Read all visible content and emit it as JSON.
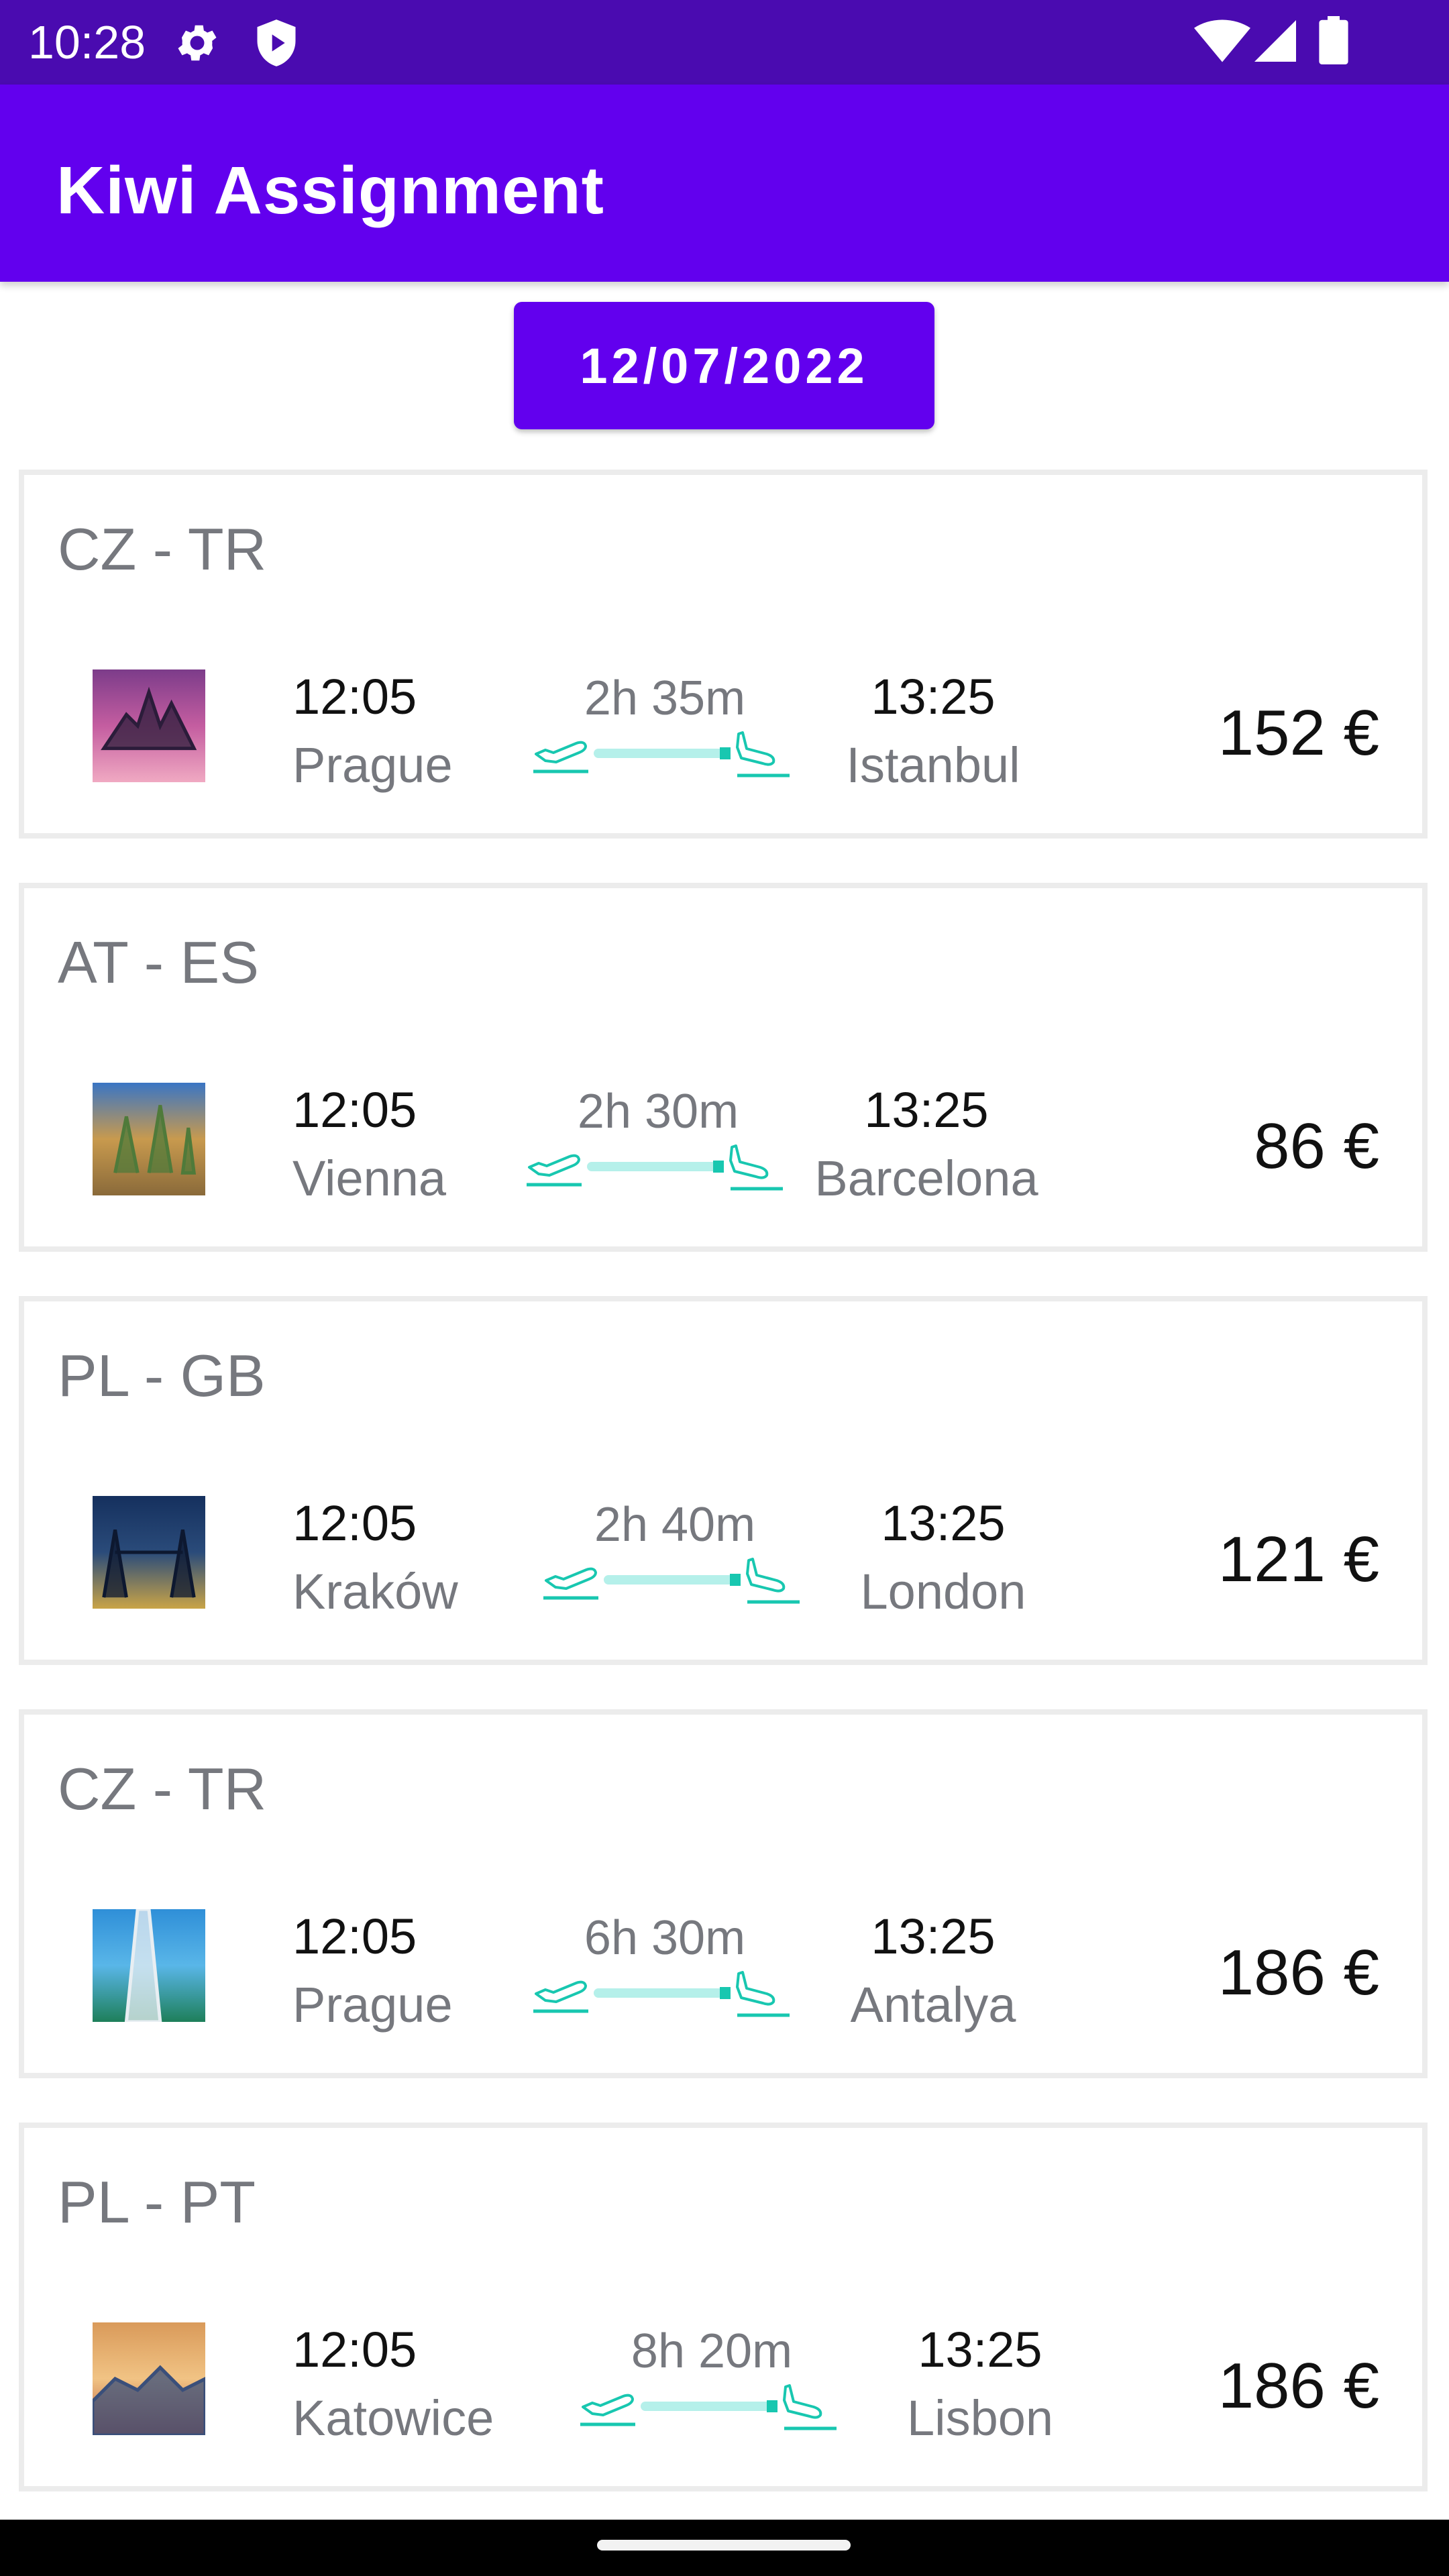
{
  "status_bar": {
    "time": "10:28",
    "icons": [
      "settings-icon",
      "shield-play-icon",
      "wifi-icon",
      "signal-icon",
      "battery-icon"
    ]
  },
  "app_bar": {
    "title": "Kiwi Assignment"
  },
  "date_button": {
    "label": "12/07/2022"
  },
  "flights": [
    {
      "route": "CZ - TR",
      "departure_time": "12:05",
      "departure_city": "Prague",
      "duration": "2h 35m",
      "arrival_time": "13:25",
      "arrival_city": "Istanbul",
      "price": "152 €",
      "image": "istanbul-thumbnail"
    },
    {
      "route": "AT - ES",
      "departure_time": "12:05",
      "departure_city": "Vienna",
      "duration": "2h 30m",
      "arrival_time": "13:25",
      "arrival_city": "Barcelona",
      "price": "86 €",
      "image": "barcelona-thumbnail"
    },
    {
      "route": "PL - GB",
      "departure_time": "12:05",
      "departure_city": "Kraków",
      "duration": "2h 40m",
      "arrival_time": "13:25",
      "arrival_city": "London",
      "price": "121 €",
      "image": "london-thumbnail"
    },
    {
      "route": "CZ - TR",
      "departure_time": "12:05",
      "departure_city": "Prague",
      "duration": "6h 30m",
      "arrival_time": "13:25",
      "arrival_city": "Antalya",
      "price": "186 €",
      "image": "antalya-thumbnail"
    },
    {
      "route": "PL - PT",
      "departure_time": "12:05",
      "departure_city": "Katowice",
      "duration": "8h 20m",
      "arrival_time": "13:25",
      "arrival_city": "Lisbon",
      "price": "186 €",
      "image": "lisbon-thumbnail"
    }
  ],
  "colors": {
    "primary": "#6200ee",
    "status_bar": "#4a0bb0",
    "flight_line": "#b5f0ea",
    "flight_accent": "#18c7b0",
    "muted_text": "#76787e"
  }
}
